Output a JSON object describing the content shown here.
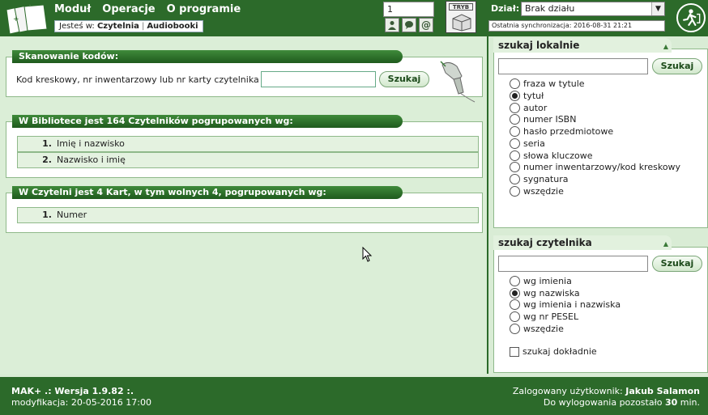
{
  "header": {
    "menu": [
      "Moduł",
      "Operacje",
      "O programie"
    ],
    "crumb_prefix": "Jesteś w:",
    "crumb_current": "Czytelnia",
    "crumb_other": "Audiobooki",
    "number_value": "1",
    "tryb_label": "TRYB",
    "dzial_label": "Dział:",
    "dzial_value": "Brak działu",
    "sync_text": "Ostatnia synchronizacja: 2016-08-31 21:21"
  },
  "scan": {
    "title": "Skanowanie kodów:",
    "label": "Kod kreskowy, nr inwentarzowy lub nr karty czytelnika",
    "input_value": "",
    "button": "Szukaj"
  },
  "readers": {
    "title": "W Bibliotece jest 164 Czytelników pogrupowanych wg:",
    "rows": [
      {
        "num": "1.",
        "label": "Imię i nazwisko"
      },
      {
        "num": "2.",
        "label": "Nazwisko i imię"
      }
    ]
  },
  "cards": {
    "title": "W Czytelni jest 4 Kart, w tym wolnych 4, pogrupowanych wg:",
    "rows": [
      {
        "num": "1.",
        "label": "Numer"
      }
    ]
  },
  "local_search": {
    "title": "szukaj lokalnie",
    "button": "Szukaj",
    "input_value": "",
    "options": [
      "fraza w tytule",
      "tytuł",
      "autor",
      "numer ISBN",
      "hasło przedmiotowe",
      "seria",
      "słowa kluczowe",
      "numer inwentarzowy/kod kreskowy",
      "sygnatura",
      "wszędzie"
    ],
    "selected": 1
  },
  "reader_search": {
    "title": "szukaj czytelnika",
    "button": "Szukaj",
    "input_value": "",
    "options": [
      "wg imienia",
      "wg nazwiska",
      "wg imienia i nazwiska",
      "wg nr PESEL",
      "wszędzie"
    ],
    "selected": 1,
    "exact_label": "szukaj dokładnie"
  },
  "footer": {
    "app_line": "MAK+ .: Wersja 1.9.82 :.",
    "modified_line": "modyfikacja: 20-05-2016 17:00",
    "user_prefix": "Zalogowany użytkownik:",
    "user_name": "Jakub Salamon",
    "logout_prefix": "Do wylogowania pozostało",
    "logout_minutes": "30",
    "logout_suffix": "min."
  }
}
